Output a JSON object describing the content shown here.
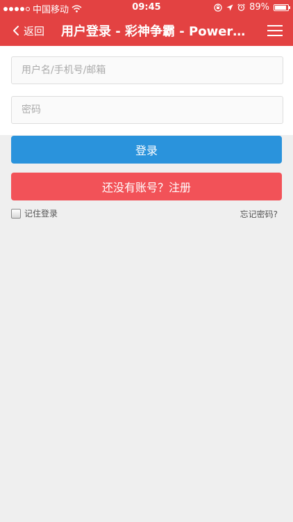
{
  "status_bar": {
    "carrier": "中国移动",
    "time": "09:45",
    "battery": "89%",
    "battery_level": 0.89
  },
  "nav": {
    "back_label": "返回",
    "title": "用户登录 - 彩神争霸 - Powere..."
  },
  "form": {
    "username_placeholder": "用户名/手机号/邮箱",
    "username_value": "",
    "password_placeholder": "密码",
    "password_value": ""
  },
  "buttons": {
    "login_label": "登录",
    "register_label": "还没有账号？注册"
  },
  "options": {
    "remember_label": "记住登录",
    "remember_checked": false,
    "forgot_label": "忘记密码?"
  },
  "colors": {
    "header": "#e34242",
    "login": "#2a93dc",
    "register": "#f25258",
    "background": "#efefef"
  }
}
